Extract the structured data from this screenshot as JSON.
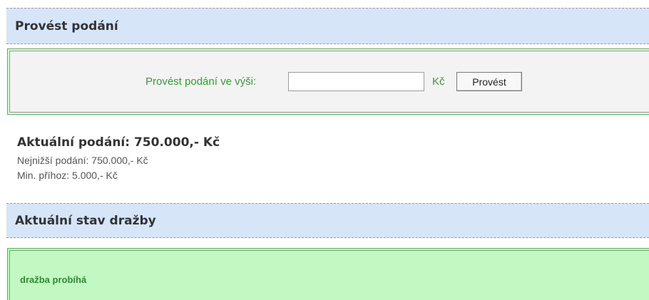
{
  "bid_section": {
    "title": "Provést podání",
    "form": {
      "label": "Provést podání ve výši:",
      "amount_value": "",
      "currency": "Kč",
      "submit_label": "Provést"
    }
  },
  "bid_info": {
    "current_bid": "Aktuální podání: 750.000,- Kč",
    "lowest_bid": "Nejnižší podání: 750.000,- Kč",
    "min_increment": "Min. příhoz: 5.000,- Kč"
  },
  "auction_status_section": {
    "title": "Aktuální stav dražby",
    "status": "dražba probíhá"
  },
  "colors": {
    "header_bg": "#d6e6f8",
    "form_bg": "#f3f3f3",
    "accent_green": "#5cb85c",
    "status_bg": "#c2f8c2",
    "label_green": "#3a9a3a"
  }
}
